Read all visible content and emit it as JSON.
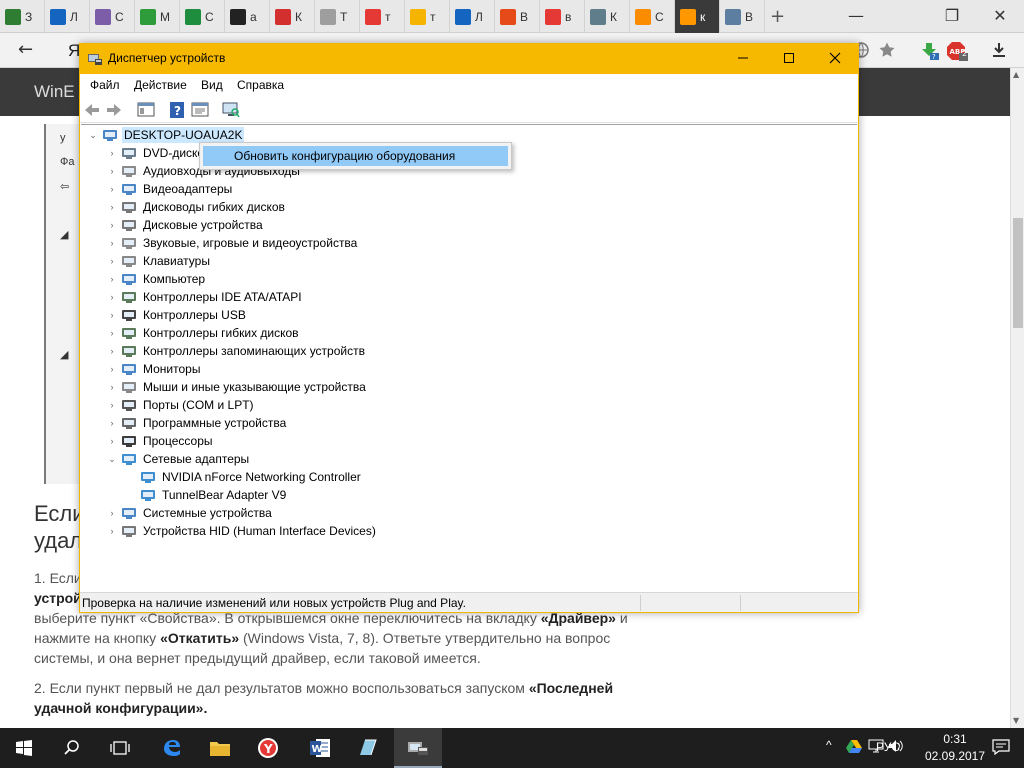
{
  "browser": {
    "tabs": [
      {
        "label": "З",
        "color": "#2e7d32"
      },
      {
        "label": "Л",
        "color": "#1565c0"
      },
      {
        "label": "С",
        "color": "#7b5ea7"
      },
      {
        "label": "М",
        "color": "#2e9c3a"
      },
      {
        "label": "С",
        "color": "#1e8e3e"
      },
      {
        "label": "а",
        "color": "#222222"
      },
      {
        "label": "К",
        "color": "#d32f2f"
      },
      {
        "label": "Т",
        "color": "#9e9e9e"
      },
      {
        "label": "т",
        "color": "#e53935"
      },
      {
        "label": "т",
        "color": "#f4b400"
      },
      {
        "label": "Л",
        "color": "#1565c0"
      },
      {
        "label": "В",
        "color": "#e64a19"
      },
      {
        "label": "в",
        "color": "#e53935"
      },
      {
        "label": "К",
        "color": "#607d8b"
      },
      {
        "label": "С",
        "color": "#fb8c00"
      },
      {
        "label": "к",
        "color": "#ff9800"
      },
      {
        "label": "В",
        "color": "#5c7ea1"
      }
    ],
    "active_tab_index": 15,
    "new_tab": "+",
    "window_controls": {
      "minimize": "—",
      "maximize": "❐",
      "close": "✕"
    },
    "back": "←",
    "address_fragment": "Я",
    "ext_badge_label": "2",
    "download_icon": "download-icon"
  },
  "site": {
    "logo": "WinE",
    "article_shot_lines": [
      "у",
      "Фа",
      "⇦",
      "",
      "◢",
      "",
      "",
      "",
      "",
      "◢",
      "",
      "",
      ""
    ],
    "heading": "Если удал",
    "p1_lead": "1. Если",
    "p1_bold": "устрой",
    "p1_rest": "выберите пункт «Свойства». В открывшемся окне переключитесь на вкладку ",
    "p1_tab": "«Драйвер»",
    "p1_and": " и",
    "p1_line3_a": "нажмите на кнопку ",
    "p1_btn": "«Откатить»",
    "p1_line3_b": " (Windows Vista, 7, 8). Ответьте утвердительно на вопрос",
    "p1_line4": "системы, и она вернет предыдущий драйвер, если таковой имеется.",
    "p2_lead": "2. Если пункт первый не дал результатов можно воспользоваться запуском ",
    "p2_bold_a": "«Последней",
    "p2_bold_b": "удачной конфигурации»."
  },
  "device_manager": {
    "title": "Диспетчер устройств",
    "menu": [
      "Файл",
      "Действие",
      "Вид",
      "Справка"
    ],
    "root": "DESKTOP-UOAUA2K",
    "categories": [
      {
        "label": "DVD-диско",
        "icon": "dvd-drive-icon"
      },
      {
        "label": "Аудиовходы и аудиовыходы",
        "icon": "audio-io-icon"
      },
      {
        "label": "Видеоадаптеры",
        "icon": "display-adapter-icon"
      },
      {
        "label": "Дисководы гибких дисков",
        "icon": "floppy-drive-icon"
      },
      {
        "label": "Дисковые устройства",
        "icon": "disk-drive-icon"
      },
      {
        "label": "Звуковые, игровые и видеоустройства",
        "icon": "sound-device-icon"
      },
      {
        "label": "Клавиатуры",
        "icon": "keyboard-icon"
      },
      {
        "label": "Компьютер",
        "icon": "computer-icon"
      },
      {
        "label": "Контроллеры IDE ATA/ATAPI",
        "icon": "ide-controller-icon"
      },
      {
        "label": "Контроллеры USB",
        "icon": "usb-controller-icon"
      },
      {
        "label": "Контроллеры гибких дисков",
        "icon": "floppy-controller-icon"
      },
      {
        "label": "Контроллеры запоминающих устройств",
        "icon": "storage-controller-icon"
      },
      {
        "label": "Мониторы",
        "icon": "monitor-icon"
      },
      {
        "label": "Мыши и иные указывающие устройства",
        "icon": "mouse-icon"
      },
      {
        "label": "Порты (COM и LPT)",
        "icon": "port-icon"
      },
      {
        "label": "Программные устройства",
        "icon": "software-device-icon"
      },
      {
        "label": "Процессоры",
        "icon": "processor-icon"
      },
      {
        "label": "Сетевые адаптеры",
        "icon": "network-adapter-icon",
        "expanded": true,
        "children": [
          "NVIDIA nForce Networking Controller",
          "TunnelBear Adapter V9"
        ]
      },
      {
        "label": "Системные устройства",
        "icon": "system-device-icon"
      },
      {
        "label": "Устройства HID (Human Interface Devices)",
        "icon": "hid-device-icon"
      }
    ],
    "context_menu_item": "Обновить конфигурацию оборудования",
    "status": "Проверка на наличие изменений или новых устройств Plug and Play."
  },
  "taskbar": {
    "tray_lang": "РУС",
    "time": "0:31",
    "date": "02.09.2017",
    "show_hidden": "^"
  },
  "colors": {
    "titlebar": "#f7b900",
    "selection": "#cce8ff",
    "menu_highlight": "#91c9f7",
    "taskbar": "#1e1e1e"
  }
}
